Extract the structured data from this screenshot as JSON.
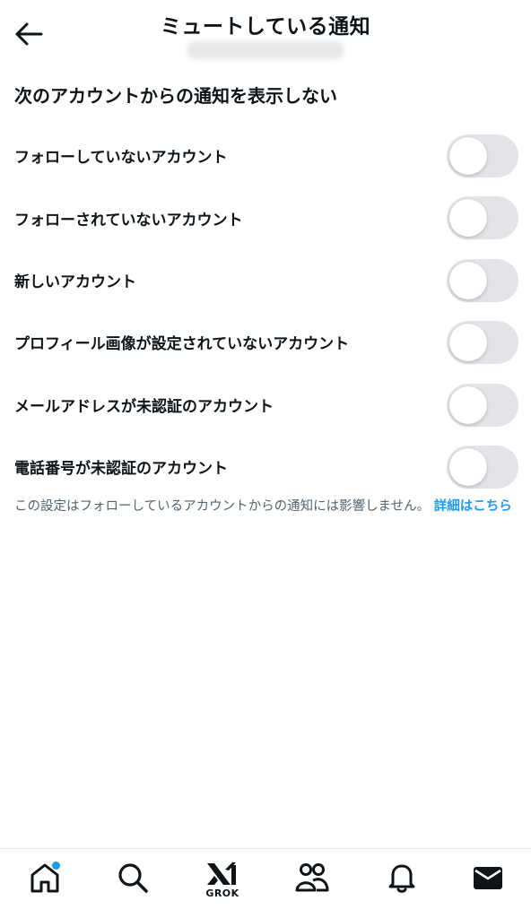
{
  "header": {
    "title": "ミュートしている通知"
  },
  "section": {
    "heading": "次のアカウントからの通知を表示しない"
  },
  "options": [
    {
      "label": "フォローしていないアカウント",
      "enabled": false
    },
    {
      "label": "フォローされていないアカウント",
      "enabled": false
    },
    {
      "label": "新しいアカウント",
      "enabled": false
    },
    {
      "label": "プロフィール画像が設定されていないアカウント",
      "enabled": false
    },
    {
      "label": "メールアドレスが未認証のアカウント",
      "enabled": false
    },
    {
      "label": "電話番号が未認証のアカウント",
      "enabled": false
    }
  ],
  "note": {
    "text": "この設定はフォローしているアカウントからの通知には影響しません。",
    "link": "詳細はこちら"
  },
  "nav": {
    "grok_label": "GROK"
  },
  "colors": {
    "accent": "#1d9bf0",
    "toggle_off": "#e3e3e8",
    "secondary_text": "#536471"
  }
}
